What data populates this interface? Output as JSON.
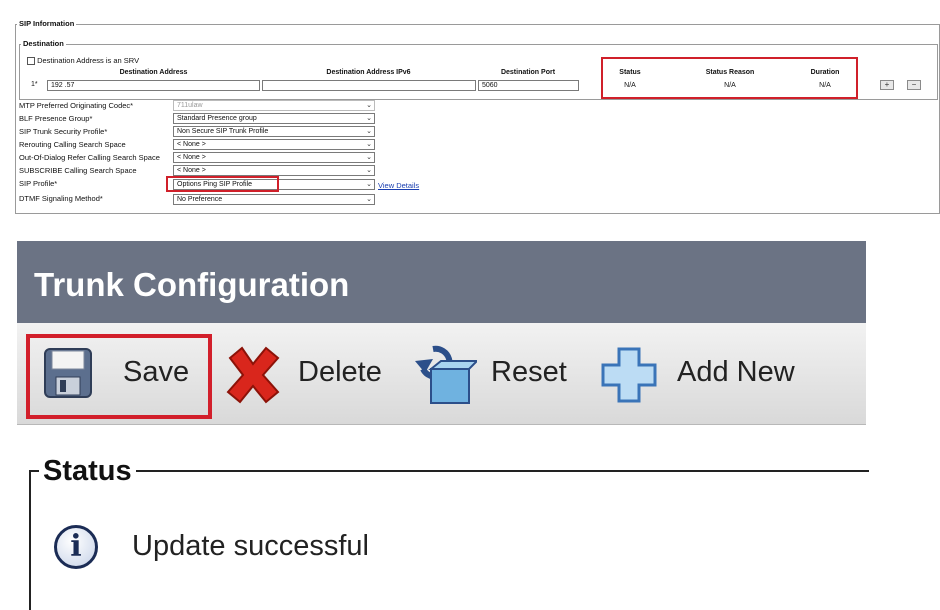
{
  "sip_info": {
    "legend": "SIP Information",
    "destination": {
      "legend": "Destination",
      "srv_checkbox_label": "Destination Address is an SRV",
      "srv_checked": false,
      "headers": {
        "address": "Destination Address",
        "ipv6": "Destination Address IPv6",
        "port": "Destination Port",
        "status": "Status",
        "status_reason": "Status Reason",
        "duration": "Duration"
      },
      "row": {
        "index": "1*",
        "address": "192 .57",
        "ipv6": "",
        "port": "5060",
        "status": "N/A",
        "status_reason": "N/A",
        "duration": "N/A"
      },
      "add_button": "+",
      "remove_button": "−"
    },
    "fields": [
      {
        "label": "MTP Preferred Originating Codec*",
        "value": "711ulaw",
        "disabled": true
      },
      {
        "label": "BLF Presence Group*",
        "value": "Standard Presence group"
      },
      {
        "label": "SIP Trunk Security Profile*",
        "value": "Non Secure SIP Trunk Profile"
      },
      {
        "label": "Rerouting Calling Search Space",
        "value": "< None >"
      },
      {
        "label": "Out-Of-Dialog Refer Calling Search Space",
        "value": "< None >"
      },
      {
        "label": "SUBSCRIBE Calling Search Space",
        "value": "< None >"
      },
      {
        "label": "SIP Profile*",
        "value": "Options Ping SIP Profile",
        "link": "View Details"
      },
      {
        "label": "DTMF Signaling Method*",
        "value": "No Preference"
      }
    ]
  },
  "trunk": {
    "title": "Trunk Configuration",
    "toolbar": {
      "save": "Save",
      "delete": "Delete",
      "reset": "Reset",
      "add_new": "Add New"
    },
    "status": {
      "legend": "Status",
      "message": "Update successful",
      "icon": "info-icon"
    }
  },
  "colors": {
    "highlight_red": "#d21f2b",
    "title_bar": "#6b7384",
    "link_blue": "#1a3fb0"
  }
}
